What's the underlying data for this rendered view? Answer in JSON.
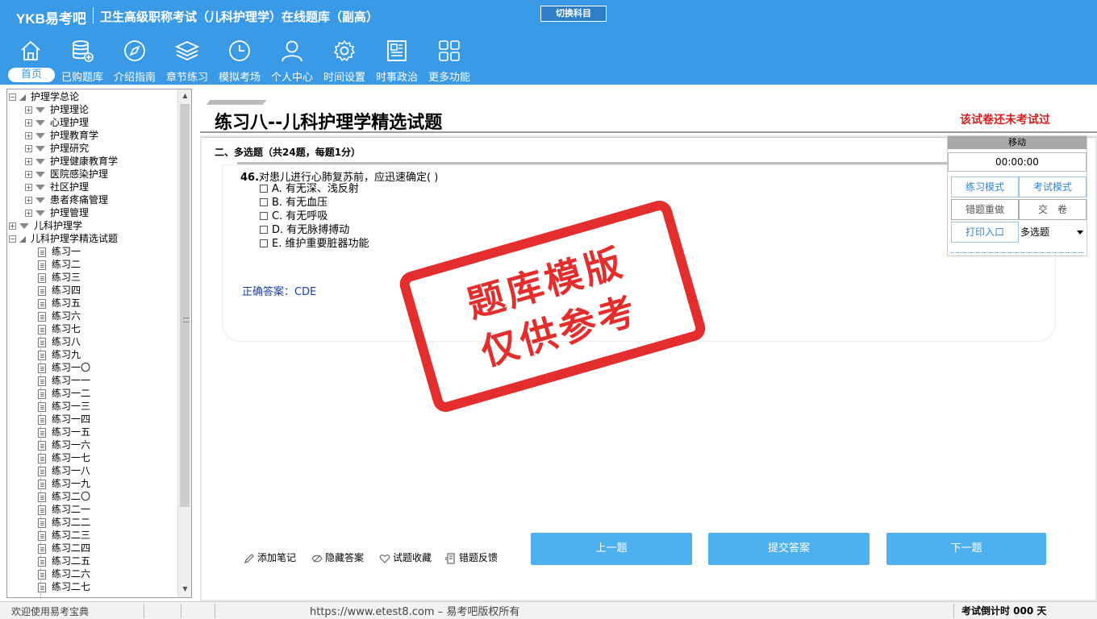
{
  "app": {
    "logo": "YKB易考吧",
    "title": "卫生高级职称考试（儿科护理学）在线题库（副高）",
    "switch_label": "切换科目"
  },
  "nav": [
    {
      "label": "首页",
      "icon": "home-icon",
      "active": true
    },
    {
      "label": "已购题库",
      "icon": "database-icon"
    },
    {
      "label": "介绍指南",
      "icon": "compass-icon"
    },
    {
      "label": "章节练习",
      "icon": "layers-icon"
    },
    {
      "label": "模拟考场",
      "icon": "clock-icon"
    },
    {
      "label": "个人中心",
      "icon": "user-icon"
    },
    {
      "label": "时间设置",
      "icon": "gear-icon"
    },
    {
      "label": "时事政治",
      "icon": "news-icon"
    },
    {
      "label": "更多功能",
      "icon": "grid-icon"
    }
  ],
  "tree": {
    "root1": "护理学总论",
    "root1_children": [
      "护理理论",
      "心理护理",
      "护理教育学",
      "护理研究",
      "护理健康教育学",
      "医院感染护理",
      "社区护理",
      "患者疼痛管理",
      "护理管理"
    ],
    "root2": "儿科护理学",
    "root3": "儿科护理学精选试题",
    "exercises": [
      "练习一",
      "练习二",
      "练习三",
      "练习四",
      "练习五",
      "练习六",
      "练习七",
      "练习八",
      "练习九",
      "练习一〇",
      "练习一一",
      "练习一二",
      "练习一三",
      "练习一四",
      "练习一五",
      "练习一六",
      "练习一七",
      "练习一八",
      "练习一九",
      "练习二〇",
      "练习二一",
      "练习二二",
      "练习二三",
      "练习二四",
      "练习二五",
      "练习二六",
      "练习二七"
    ]
  },
  "main": {
    "page_title": "练习八--儿科护理学精选试题",
    "status": "该试卷还未考试过",
    "section": "二、多选题（共24题，每题1分）",
    "question_no": "46.",
    "question": "对患儿进行心肺复苏前，应迅速确定( )",
    "options": [
      "A. 有无深、浅反射",
      "B. 有无血压",
      "C. 有无呼吸",
      "D. 有无脉搏搏动",
      "E. 维护重要脏器功能"
    ],
    "answer": "正确答案：CDE",
    "tools": [
      "添加笔记",
      "隐藏答案",
      "试题收藏",
      "错题反馈"
    ],
    "prev": "上一题",
    "submit": "提交答案",
    "next": "下一题"
  },
  "panel": {
    "move": "移动",
    "timer": "00:00:00",
    "practice_mode": "练习模式",
    "exam_mode": "考试模式",
    "redo_wrong": "错题重做",
    "hand_in": "交　卷",
    "print": "打印入口",
    "type_select": "多选题"
  },
  "stamp": {
    "line1": "题库模版",
    "line2": "仅供参考"
  },
  "statusbar": {
    "welcome": "欢迎使用易考宝典",
    "copyright": "https://www.etest8.com – 易考吧版权所有",
    "countdown": "考试倒计时 000 天"
  },
  "colors": {
    "topbar": "#3b9ae6",
    "button": "#4db1f0",
    "alert": "#d62020",
    "answer": "#1a3fa8",
    "stamp": "#e32222"
  }
}
